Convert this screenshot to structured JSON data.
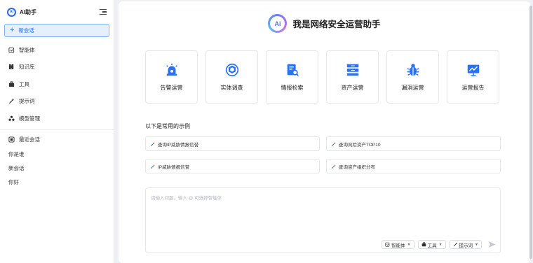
{
  "sidebar": {
    "brand": "AI助手",
    "logo_text": "Ai",
    "new_chat": "新会话",
    "nav": [
      {
        "label": "智能体",
        "icon": "agent-icon"
      },
      {
        "label": "知识库",
        "icon": "book-icon"
      },
      {
        "label": "工具",
        "icon": "toolbox-icon"
      },
      {
        "label": "提示词",
        "icon": "wand-icon"
      },
      {
        "label": "模型管理",
        "icon": "model-icon"
      }
    ],
    "recent_title": "最近会话",
    "recent": [
      "你是谁",
      "新会话",
      "你好"
    ]
  },
  "main": {
    "logo_text": "Ai",
    "title": "我是网络安全运营助手",
    "cards": [
      {
        "label": "告警运营",
        "icon": "alarm-icon"
      },
      {
        "label": "实体调查",
        "icon": "entity-icon"
      },
      {
        "label": "情报检索",
        "icon": "doc-search-icon"
      },
      {
        "label": "资产运营",
        "icon": "server-icon"
      },
      {
        "label": "漏洞运营",
        "icon": "bug-icon"
      },
      {
        "label": "运营报告",
        "icon": "report-icon"
      }
    ],
    "examples_title": "以下是常用的示例",
    "examples": [
      "查询IP威胁情报信誉",
      "查询风险资产TOP10",
      "IP威胁情报信誉",
      "查询资产组织分布"
    ],
    "input_placeholder": "请输入问题。输入 @ 可选择智能体",
    "tools": [
      "智能体",
      "工具",
      "提示词"
    ]
  },
  "colors": {
    "accent": "#1f6fe5",
    "icon_blue": "#2a72f0"
  }
}
